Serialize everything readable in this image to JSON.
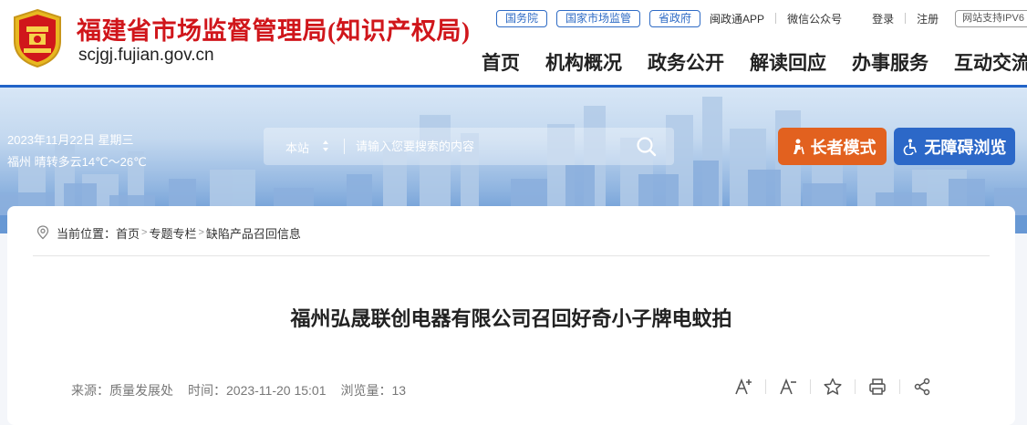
{
  "header": {
    "site_title": "福建省市场监督管理局(知识产权局)",
    "site_domain": "scjgj.fujian.gov.cn",
    "top_links": {
      "pills": [
        "国务院",
        "国家市场监管",
        "省政府"
      ],
      "app": "闽政通APP",
      "wechat": "微信公众号",
      "login": "登录",
      "register": "注册",
      "ipv6": "网站支持IPV6"
    },
    "nav": [
      "首页",
      "机构概况",
      "政务公开",
      "解读回应",
      "办事服务",
      "互动交流"
    ]
  },
  "banner": {
    "date": "2023年11月22日 星期三",
    "weather": "福州 晴转多云14℃～26℃",
    "search": {
      "scope": "本站",
      "placeholder": "请输入您要搜索的内容"
    },
    "elder_mode": "长者模式",
    "accessible": "无障碍浏览"
  },
  "breadcrumb": {
    "prefix": "当前位置：",
    "items": [
      "首页",
      "专题专栏",
      "缺陷产品召回信息"
    ]
  },
  "article": {
    "title": "福州弘晟联创电器有限公司召回好奇小子牌电蚊拍",
    "source": "来源：质量发展处",
    "time": "时间：2023-11-20 15:01",
    "views": "浏览量：13"
  },
  "colors": {
    "brand_red": "#d0161b",
    "nav_blue": "#2163c8",
    "elder_orange": "#e2611f",
    "access_blue": "#2c68c8"
  },
  "icons": [
    "emblem-icon",
    "search-icon",
    "elder-icon",
    "accessibility-icon",
    "location-pin-icon",
    "font-increase-icon",
    "font-decrease-icon",
    "favorite-star-icon",
    "print-icon",
    "share-icon"
  ]
}
